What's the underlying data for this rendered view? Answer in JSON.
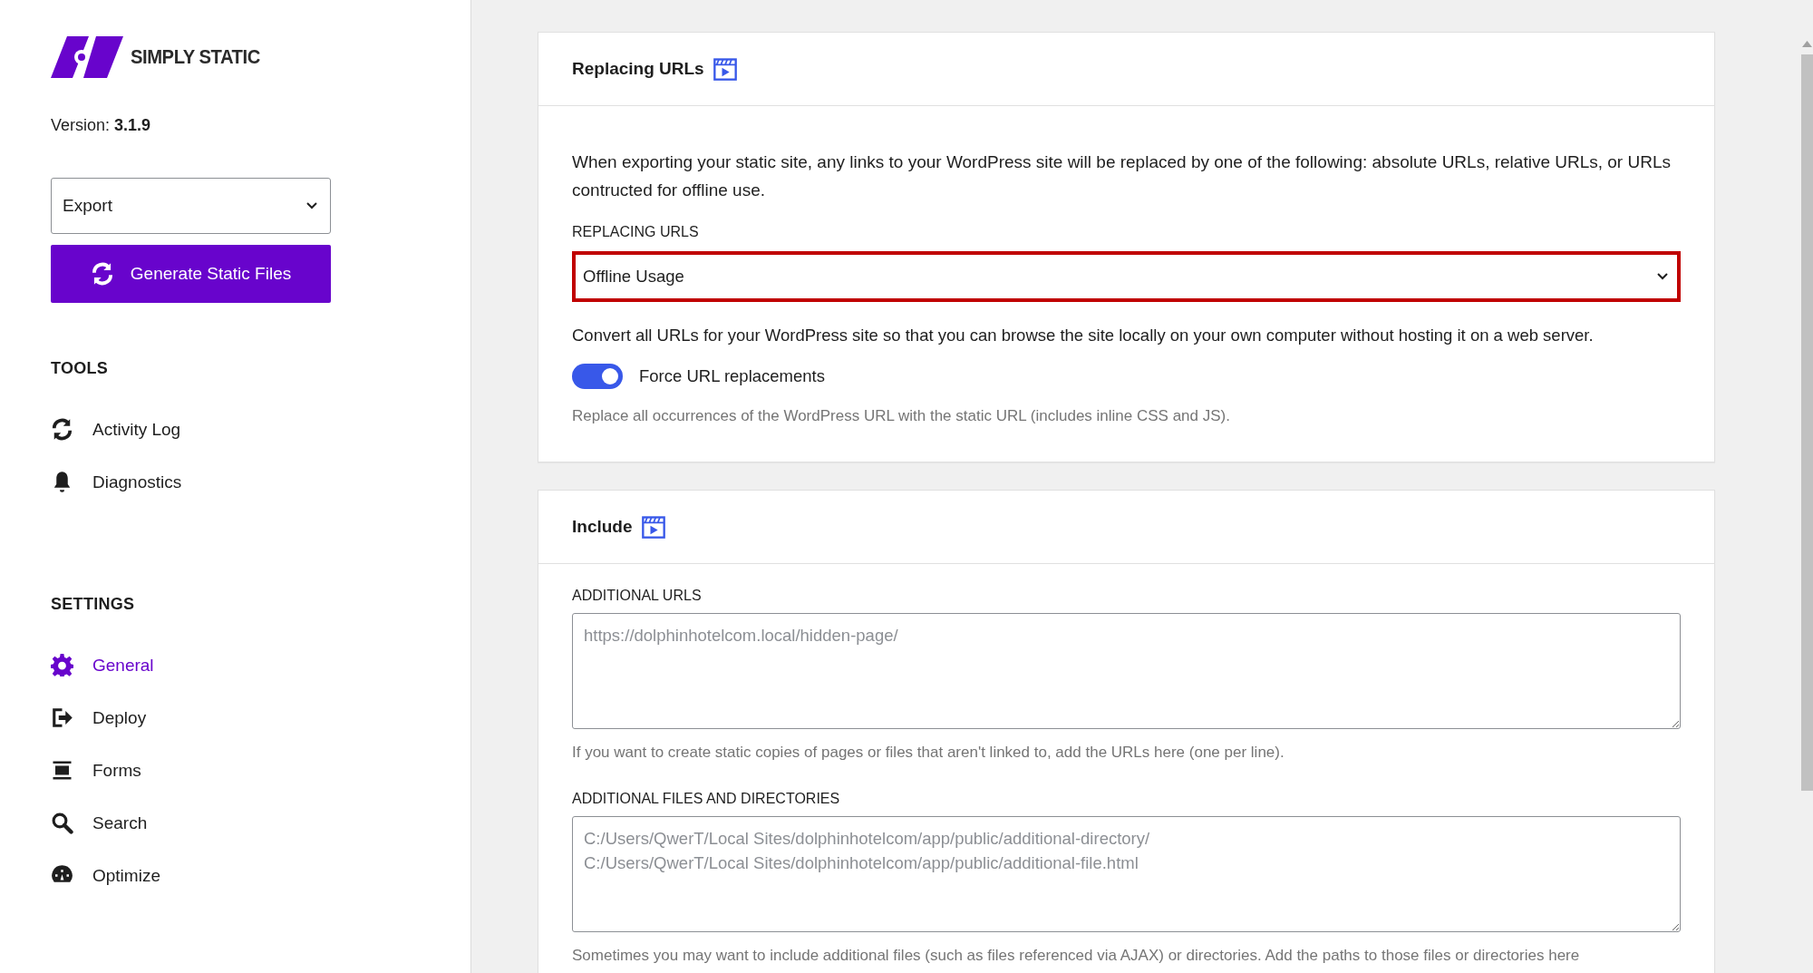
{
  "sidebar": {
    "brand": "SIMPLY STATIC",
    "version_label": "Version:",
    "version": "3.1.9",
    "mode_select": {
      "value": "Export"
    },
    "generate_button": "Generate Static Files",
    "tools": {
      "heading": "TOOLS",
      "items": [
        {
          "label": "Activity Log",
          "selected": false
        },
        {
          "label": "Diagnostics",
          "selected": false
        }
      ]
    },
    "settings": {
      "heading": "SETTINGS",
      "items": [
        {
          "label": "General",
          "selected": true
        },
        {
          "label": "Deploy",
          "selected": false
        },
        {
          "label": "Forms",
          "selected": false
        },
        {
          "label": "Search",
          "selected": false
        },
        {
          "label": "Optimize",
          "selected": false
        }
      ]
    }
  },
  "replacing_urls_card": {
    "title": "Replacing URLs",
    "description": "When exporting your static site, any links to your WordPress site will be replaced by one of the following: absolute URLs, relative URLs, or URLs contructed for offline use.",
    "field_label": "REPLACING URLS",
    "select": {
      "value": "Offline Usage",
      "highlighted": true
    },
    "select_hint": "Convert all URLs for your WordPress site so that you can browse the site locally on your own computer without hosting it on a web server.",
    "toggle": {
      "label": "Force URL replacements",
      "on": true
    },
    "toggle_hint": "Replace all occurrences of the WordPress URL with the static URL (includes inline CSS and JS)."
  },
  "include_card": {
    "title": "Include",
    "fields": [
      {
        "label": "ADDITIONAL URLS",
        "placeholder": "https://dolphinhotelcom.local/hidden-page/",
        "hint": "If you want to create static copies of pages or files that aren't linked to, add the URLs here (one per line)."
      },
      {
        "label": "ADDITIONAL FILES AND DIRECTORIES",
        "placeholder": "C:/Users/QwerT/Local Sites/dolphinhotelcom/app/public/additional-directory/\nC:/Users/QwerT/Local Sites/dolphinhotelcom/app/public/additional-file.html",
        "hint": "Sometimes you may want to include additional files (such as files referenced via AJAX) or directories. Add the paths to those files or directories here"
      }
    ]
  }
}
